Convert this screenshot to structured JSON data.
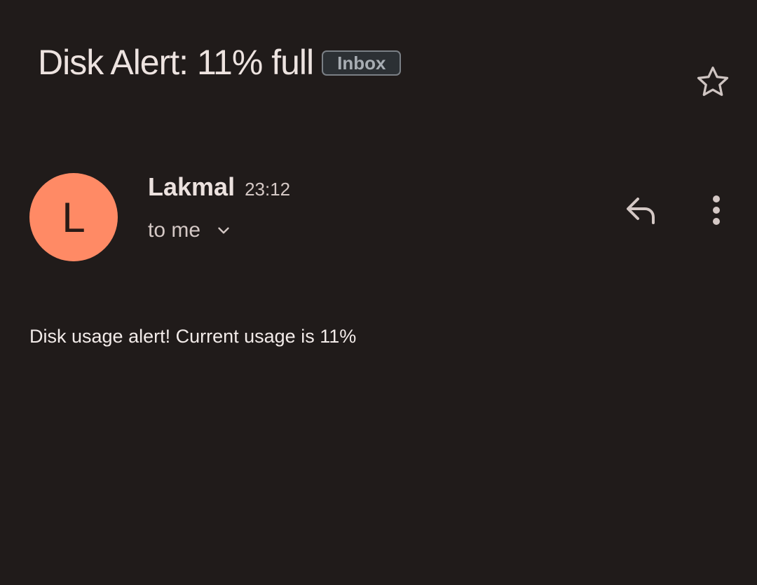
{
  "email": {
    "subject": "Disk Alert: 11% full",
    "label": "Inbox",
    "starred": false,
    "sender": {
      "name": "Lakmal",
      "initial": "L",
      "avatar_color": "#ff8a65"
    },
    "time": "23:12",
    "recipient": "to me",
    "body": "Disk usage alert! Current usage is 11%"
  },
  "icons": {
    "star": "star-outline-icon",
    "expand": "chevron-down-icon",
    "reply": "reply-icon",
    "more": "more-vert-icon"
  },
  "colors": {
    "background": "#201b1a",
    "text": "#ebe0de",
    "chip_border": "#7a7f85",
    "chip_background": "#2c3034"
  }
}
